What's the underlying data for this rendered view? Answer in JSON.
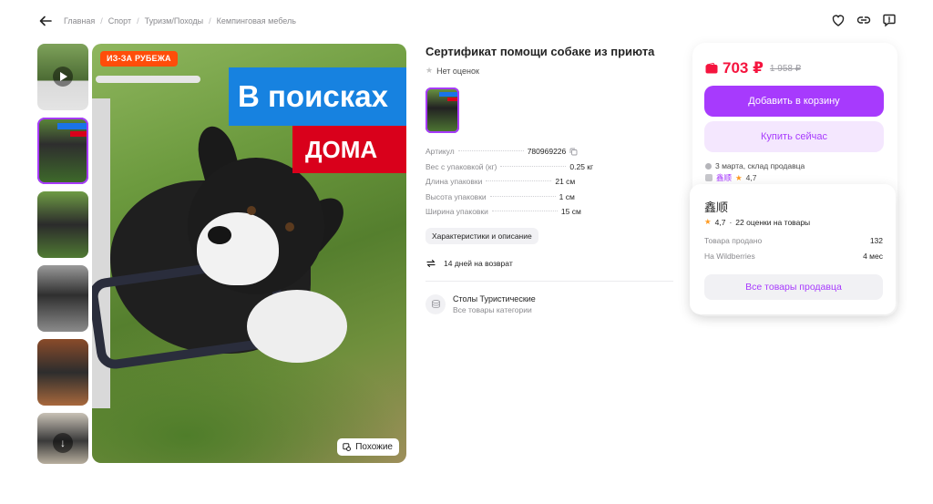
{
  "breadcrumb": [
    "Главная",
    "Спорт",
    "Туризм/Походы",
    "Кемпинговая мебель"
  ],
  "gallery": {
    "badge": "ИЗ-ЗА РУБЕЖА",
    "banner_line1": "В поисках",
    "banner_line2": "ДОМА",
    "similar_label": "Похожие"
  },
  "product": {
    "title": "Сертификат помощи собаке из приюта",
    "rating_text": "Нет оценок",
    "specs": [
      {
        "key": "Артикул",
        "value": "780969226"
      },
      {
        "key": "Вес с упаковкой (кг)",
        "value": "0.25 кг"
      },
      {
        "key": "Длина упаковки",
        "value": "21 см"
      },
      {
        "key": "Высота упаковки",
        "value": "1 см"
      },
      {
        "key": "Ширина упаковки",
        "value": "15 см"
      }
    ],
    "chars_button": "Характеристики и описание",
    "return_text": "14 дней на возврат",
    "category_title": "Столы Туристические",
    "category_sub": "Все товары категории"
  },
  "buy": {
    "price": "703 ₽",
    "old_price": "1 958 ₽",
    "add_to_cart": "Добавить в корзину",
    "buy_now": "Купить сейчас",
    "delivery": "3 марта, склад продавца",
    "seller_short": "鑫顺",
    "seller_rating": "4,7"
  },
  "seller": {
    "name": "鑫顺",
    "rating": "4,7",
    "reviews": "22 оценки на товары",
    "sold_label": "Товара продано",
    "sold_value": "132",
    "on_wb_label": "На Wildberries",
    "on_wb_value": "4 мес",
    "all_products": "Все товары продавца"
  },
  "colors": {
    "accent": "#a73afd",
    "price": "#f5143e",
    "star": "#ff9a1f"
  },
  "icons": [
    "back-arrow-icon",
    "heart-icon",
    "link-icon",
    "report-icon",
    "play-icon",
    "down-arrow-icon",
    "similar-icon",
    "copy-icon",
    "return-icon",
    "category-icon",
    "wallet-icon"
  ]
}
